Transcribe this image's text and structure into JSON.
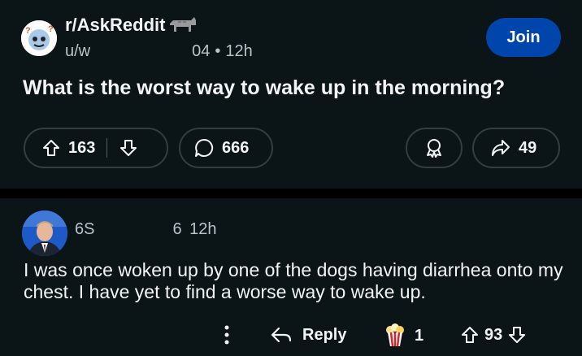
{
  "post": {
    "subreddit": "r/AskReddit",
    "author_prefix": "u/w",
    "author_suffix": "04",
    "age": "12h",
    "join_label": "Join",
    "title": "What is the worst way to wake up in the morning?",
    "upvotes": "163",
    "comments": "666",
    "shares": "49"
  },
  "comment": {
    "author_prefix": "6S",
    "author_suffix": "6",
    "age": "12h",
    "body": "I was once woken up by one of the dogs having diarrhea onto my chest. I have yet to find a worse way to wake up.",
    "reply_label": "Reply",
    "award_count": "1",
    "score": "93"
  },
  "colors": {
    "background": "#0b1416",
    "join_button": "#0045ac",
    "pill_border": "#333d42",
    "muted_text": "#b7c5cb"
  },
  "icons": [
    "subreddit-icon",
    "award-icon",
    "upvote-icon",
    "downvote-icon",
    "comment-icon",
    "award-outline-icon",
    "share-icon",
    "more-icon",
    "reply-icon",
    "popcorn-icon"
  ]
}
